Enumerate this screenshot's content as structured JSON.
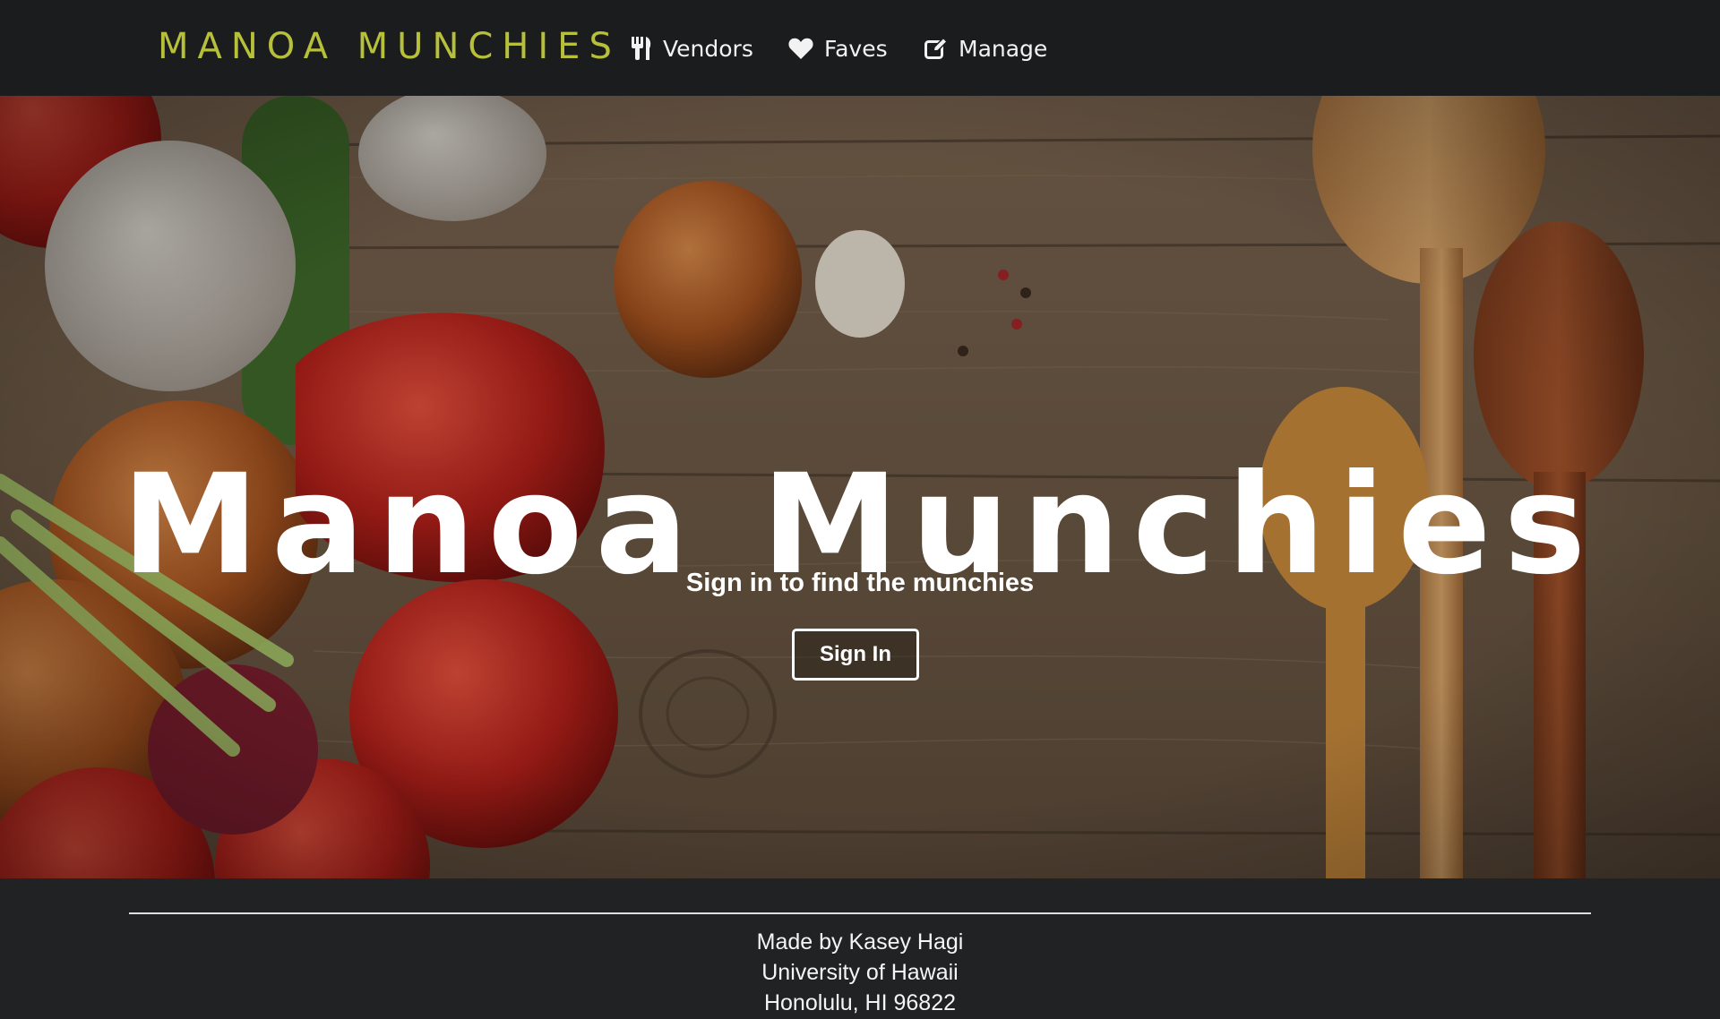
{
  "navbar": {
    "brand": "MANOA MUNCHIES",
    "items": [
      {
        "label": "Vendors",
        "icon": "utensils-icon"
      },
      {
        "label": "Faves",
        "icon": "heart-icon"
      },
      {
        "label": "Manage",
        "icon": "edit-icon"
      }
    ]
  },
  "hero": {
    "title": "Manoa Munchies",
    "subtitle": "Sign in to find the munchies",
    "button_label": "Sign In"
  },
  "footer": {
    "lines": [
      "Made by Kasey Hagi",
      "University of Hawaii",
      "Honolulu, HI 96822"
    ]
  },
  "colors": {
    "navbar_bg": "#1b1c1d",
    "brand": "#b7c03a",
    "footer_bg": "#212224"
  }
}
